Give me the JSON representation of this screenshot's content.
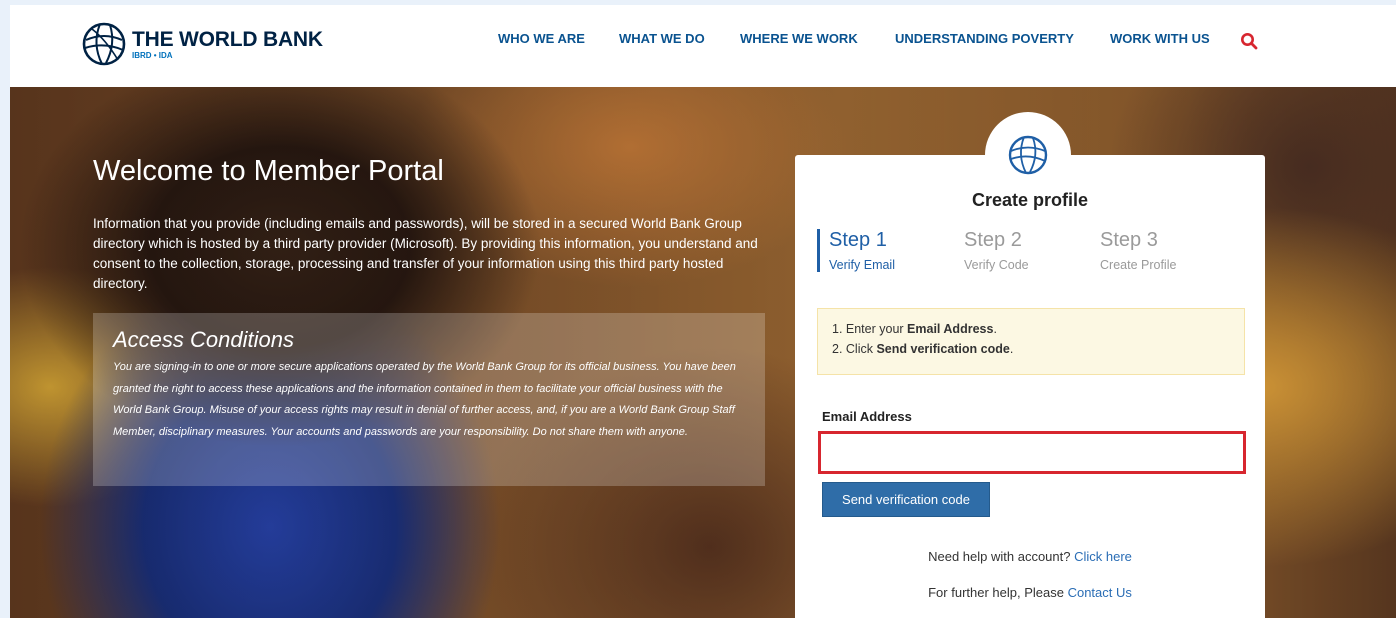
{
  "brand": {
    "title": "THE WORLD BANK",
    "subtitle": "IBRD • IDA",
    "color": "#002244",
    "accent": "#0071bc"
  },
  "nav": {
    "items": [
      {
        "label": "WHO WE ARE"
      },
      {
        "label": "WHAT WE DO"
      },
      {
        "label": "WHERE WE WORK"
      },
      {
        "label": "UNDERSTANDING POVERTY"
      },
      {
        "label": "WORK WITH US"
      }
    ],
    "search_icon": "search-icon",
    "search_color": "#d7262f"
  },
  "hero": {
    "welcome": "Welcome to Member Portal",
    "intro": "Information that you provide (including emails and passwords), will be stored in a secured World Bank Group directory which is hosted by a third party provider (Microsoft). By providing this information, you understand and consent to the collection, storage, processing and transfer of your information using this third party hosted directory.",
    "access_title": "Access Conditions",
    "access_text": "You are signing-in to one or more secure applications operated by the World Bank Group for its official business. You have been granted the right to access these applications and the information contained in them to facilitate your official business with the World Bank Group. Misuse of your access rights may result in denial of further access, and, if you are a World Bank Group Staff Member, disciplinary measures. Your accounts and passwords are your responsibility. Do not share them with anyone."
  },
  "card": {
    "title": "Create profile",
    "steps": [
      {
        "num": "Step 1",
        "label": "Verify Email",
        "active": true
      },
      {
        "num": "Step 2",
        "label": "Verify Code",
        "active": false
      },
      {
        "num": "Step 3",
        "label": "Create Profile",
        "active": false
      }
    ],
    "instructions": {
      "line1_prefix": "1. Enter your ",
      "line1_bold": "Email Address",
      "line1_suffix": ".",
      "line2_prefix": "2. Click ",
      "line2_bold": "Send verification code",
      "line2_suffix": "."
    },
    "email_label": "Email Address",
    "email_value": "",
    "send_button": "Send verification code",
    "help1_text": "Need help with account? ",
    "help1_link": "Click here",
    "help2_text": "For further help, Please ",
    "help2_link": "Contact Us"
  }
}
